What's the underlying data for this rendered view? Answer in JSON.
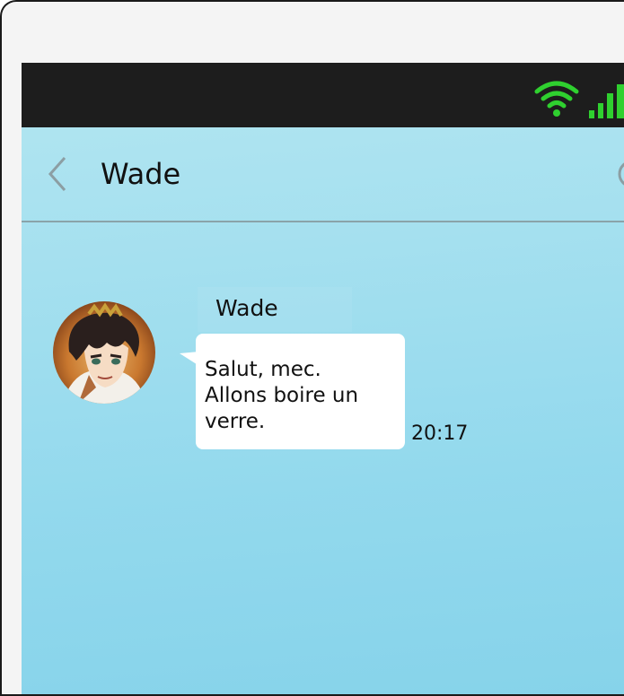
{
  "header": {
    "title": "Wade"
  },
  "conversation": {
    "messages": [
      {
        "sender": "Wade",
        "text": "Salut, mec.\nAllons boire un\nverre.",
        "time": "20:17"
      }
    ]
  },
  "icons": {
    "back": "chevron-left-icon",
    "wifi": "wifi-icon",
    "signal": "signal-icon",
    "more": "more-icon"
  },
  "colors": {
    "status_bar": "#1d1d1d",
    "signal_green": "#2fd02f",
    "chat_bg_top": "#b3e6f1",
    "chat_bg_bottom": "#86d3ea",
    "bubble": "#ffffff",
    "divider": "#8aa3a9"
  }
}
